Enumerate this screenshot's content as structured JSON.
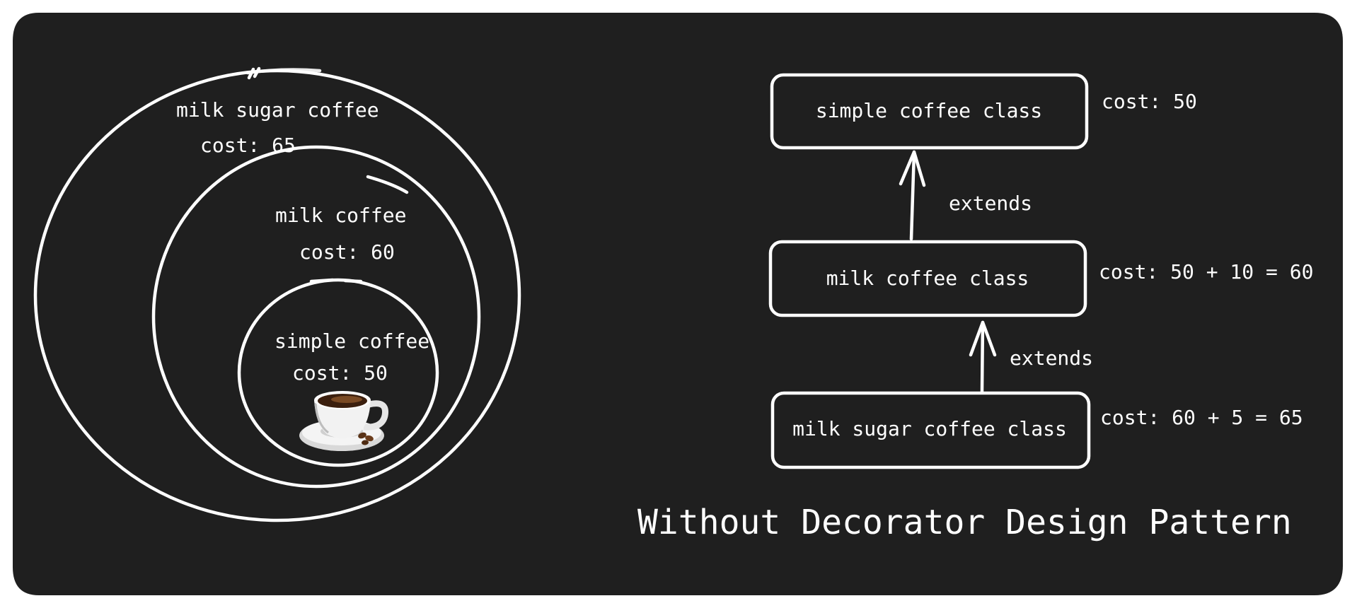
{
  "colors": {
    "background": "#1f1f1f",
    "foreground": "#ffffff"
  },
  "left_diagram": {
    "outer": {
      "name": "milk sugar coffee",
      "cost": "cost: 65"
    },
    "middle": {
      "name": "milk coffee",
      "cost": "cost: 60"
    },
    "inner": {
      "name": "simple coffee",
      "cost": "cost: 50",
      "icon": "coffee-cup-icon"
    }
  },
  "right_diagram": {
    "classes": [
      {
        "label": "simple coffee class",
        "cost": "cost: 50"
      },
      {
        "label": "milk coffee class",
        "cost": "cost: 50 + 10 = 60"
      },
      {
        "label": "milk sugar coffee class",
        "cost": "cost: 60 + 5 = 65"
      }
    ],
    "relations": [
      {
        "label": "extends"
      },
      {
        "label": "extends"
      }
    ]
  },
  "title": "Without Decorator Design Pattern"
}
